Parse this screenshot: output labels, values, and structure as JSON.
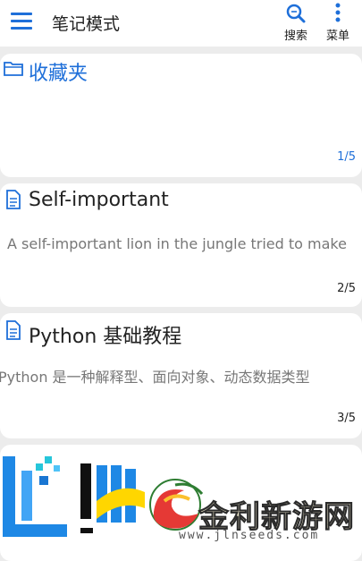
{
  "header": {
    "title": "笔记模式",
    "search_label": "搜索",
    "menu_label": "菜单"
  },
  "colors": {
    "accent": "#1e6fd9",
    "background": "#ececec"
  },
  "notes": [
    {
      "type": "folder",
      "icon": "folder-icon",
      "title": "收藏夹",
      "preview": "",
      "page": "1/5"
    },
    {
      "type": "note",
      "icon": "document-icon",
      "title": "Self-important",
      "preview": "A self-important lion in the jungle tried to make",
      "page": "2/5"
    },
    {
      "type": "note",
      "icon": "document-icon",
      "title": "Python 基础教程",
      "preview": "Python 是一种解释型、面向对象、动态数据类型",
      "page": "3/5"
    }
  ],
  "watermark": {
    "name": "金利新游网",
    "url": "www.jlnseeds.com"
  }
}
